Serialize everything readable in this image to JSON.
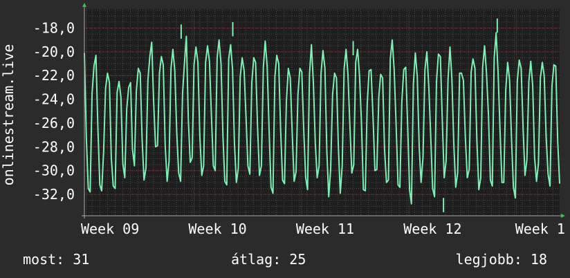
{
  "chart_data": {
    "type": "line",
    "ylabel": "onlinestream.live",
    "ylim": [
      -33.8,
      -16.4
    ],
    "yticks": [
      "-18,0",
      "-20,0",
      "-22,0",
      "-24,0",
      "-26,0",
      "-28,0",
      "-30,0",
      "-32,0"
    ],
    "ytick_values": [
      -18,
      -20,
      -22,
      -24,
      -26,
      -28,
      -30,
      -32
    ],
    "xticks": [
      "Week 09",
      "Week 10",
      "Week 11",
      "Week 12",
      "Week 1"
    ],
    "xtick_values": [
      0,
      1,
      2,
      3,
      4
    ],
    "xlim": [
      -0.02,
      4.4
    ],
    "grid": true,
    "colors": {
      "background": "#2b2b2b",
      "plot_background": "#1e1e1e",
      "grid": "#4a4a4a",
      "grid_major": "#6a3a3a",
      "line": "#7df0b4",
      "axis_arrow": "#2ecc40"
    },
    "series": [
      {
        "values": [
          -20.1,
          -27.2,
          -31.5,
          -31.8,
          -23.5,
          -21.2,
          -20.3,
          -26.4,
          -31.2,
          -31.7,
          -28.4,
          -23.1,
          -21.8,
          -22.6,
          -28.9,
          -31.3,
          -31.5,
          -23.4,
          -22.5,
          -23.8,
          -29.4,
          -30.6,
          -24.8,
          -23.0,
          -22.6,
          -28.2,
          -29.6,
          -23.3,
          -21.4,
          -21.8,
          -27.3,
          -30.8,
          -29.8,
          -22.4,
          -20.4,
          -19.2,
          -24.2,
          -28.0,
          -27.9,
          -21.8,
          -20.4,
          -21.1,
          -27.9,
          -30.9,
          -29.2,
          -21.4,
          -19.8,
          -21.6,
          -26.8,
          -30.2,
          -30.9,
          -23.5,
          -21.0,
          -18.7,
          -25.6,
          -29.3,
          -28.9,
          -21.1,
          -19.6,
          -20.9,
          -27.1,
          -30.4,
          -29.6,
          -20.9,
          -19.5,
          -20.8,
          -25.3,
          -29.6,
          -30.0,
          -20.5,
          -19.0,
          -21.0,
          -27.1,
          -30.9,
          -31.2,
          -20.6,
          -19.4,
          -21.5,
          -27.7,
          -31.0,
          -29.8,
          -22.1,
          -20.5,
          -21.6,
          -25.4,
          -29.6,
          -30.3,
          -22.6,
          -20.5,
          -20.9,
          -26.3,
          -30.4,
          -29.6,
          -21.3,
          -19.1,
          -21.2,
          -26.5,
          -31.4,
          -31.9,
          -22.1,
          -20.3,
          -21.0,
          -26.6,
          -30.8,
          -31.1,
          -24.2,
          -21.4,
          -22.2,
          -26.8,
          -30.9,
          -30.1,
          -23.6,
          -21.4,
          -21.7,
          -26.6,
          -30.6,
          -31.6,
          -21.9,
          -19.4,
          -22.6,
          -27.7,
          -30.6,
          -29.6,
          -21.8,
          -19.9,
          -21.4,
          -28.4,
          -32.2,
          -29.9,
          -23.6,
          -21.8,
          -22.2,
          -27.9,
          -31.9,
          -29.6,
          -21.4,
          -19.8,
          -21.9,
          -26.2,
          -30.2,
          -29.5,
          -20.9,
          -19.8,
          -22.0,
          -25.9,
          -31.6,
          -31.7,
          -24.3,
          -21.6,
          -21.5,
          -25.4,
          -30.0,
          -29.9,
          -23.8,
          -21.9,
          -22.2,
          -28.2,
          -31.0,
          -30.8,
          -20.6,
          -19.0,
          -21.5,
          -26.1,
          -31.2,
          -31.4,
          -24.2,
          -21.5,
          -21.3,
          -26.2,
          -31.6,
          -32.8,
          -22.7,
          -20.1,
          -22.1,
          -28.0,
          -31.0,
          -28.9,
          -21.5,
          -20.0,
          -23.0,
          -27.0,
          -31.5,
          -32.2,
          -22.5,
          -20.2,
          -20.4,
          -25.6,
          -30.6,
          -29.2,
          -22.3,
          -19.6,
          -22.2,
          -27.7,
          -31.4,
          -30.2,
          -21.8,
          -21.8,
          -22.4,
          -27.2,
          -30.6,
          -29.9,
          -21.7,
          -20.6,
          -21.4,
          -27.5,
          -31.6,
          -30.6,
          -21.3,
          -19.5,
          -21.8,
          -25.3,
          -30.8,
          -31.3,
          -20.5,
          -18.4,
          -21.7,
          -26.5,
          -31.0,
          -31.0,
          -23.2,
          -20.9,
          -22.4,
          -27.4,
          -31.4,
          -32.3,
          -22.5,
          -20.7,
          -21.4,
          -26.4,
          -30.4,
          -29.1,
          -22.5,
          -20.8,
          -22.9,
          -28.9,
          -30.9,
          -29.4,
          -22.2,
          -20.9,
          -22.0,
          -27.1,
          -30.3,
          -31.3,
          -22.9,
          -21.1,
          -21.2,
          -27.5,
          -31.1
        ],
        "annotations": [
          {
            "x": 0.88,
            "y": -18.9
          },
          {
            "x": 1.36,
            "y": -18.7
          },
          {
            "x": 2.48,
            "y": -20.3
          },
          {
            "x": 3.32,
            "y": -33.5
          },
          {
            "x": 3.82,
            "y": -18.4
          }
        ]
      }
    ]
  },
  "footer": {
    "now": "most: 31",
    "avg": "átlag: 25",
    "best": "legjobb: 18"
  }
}
